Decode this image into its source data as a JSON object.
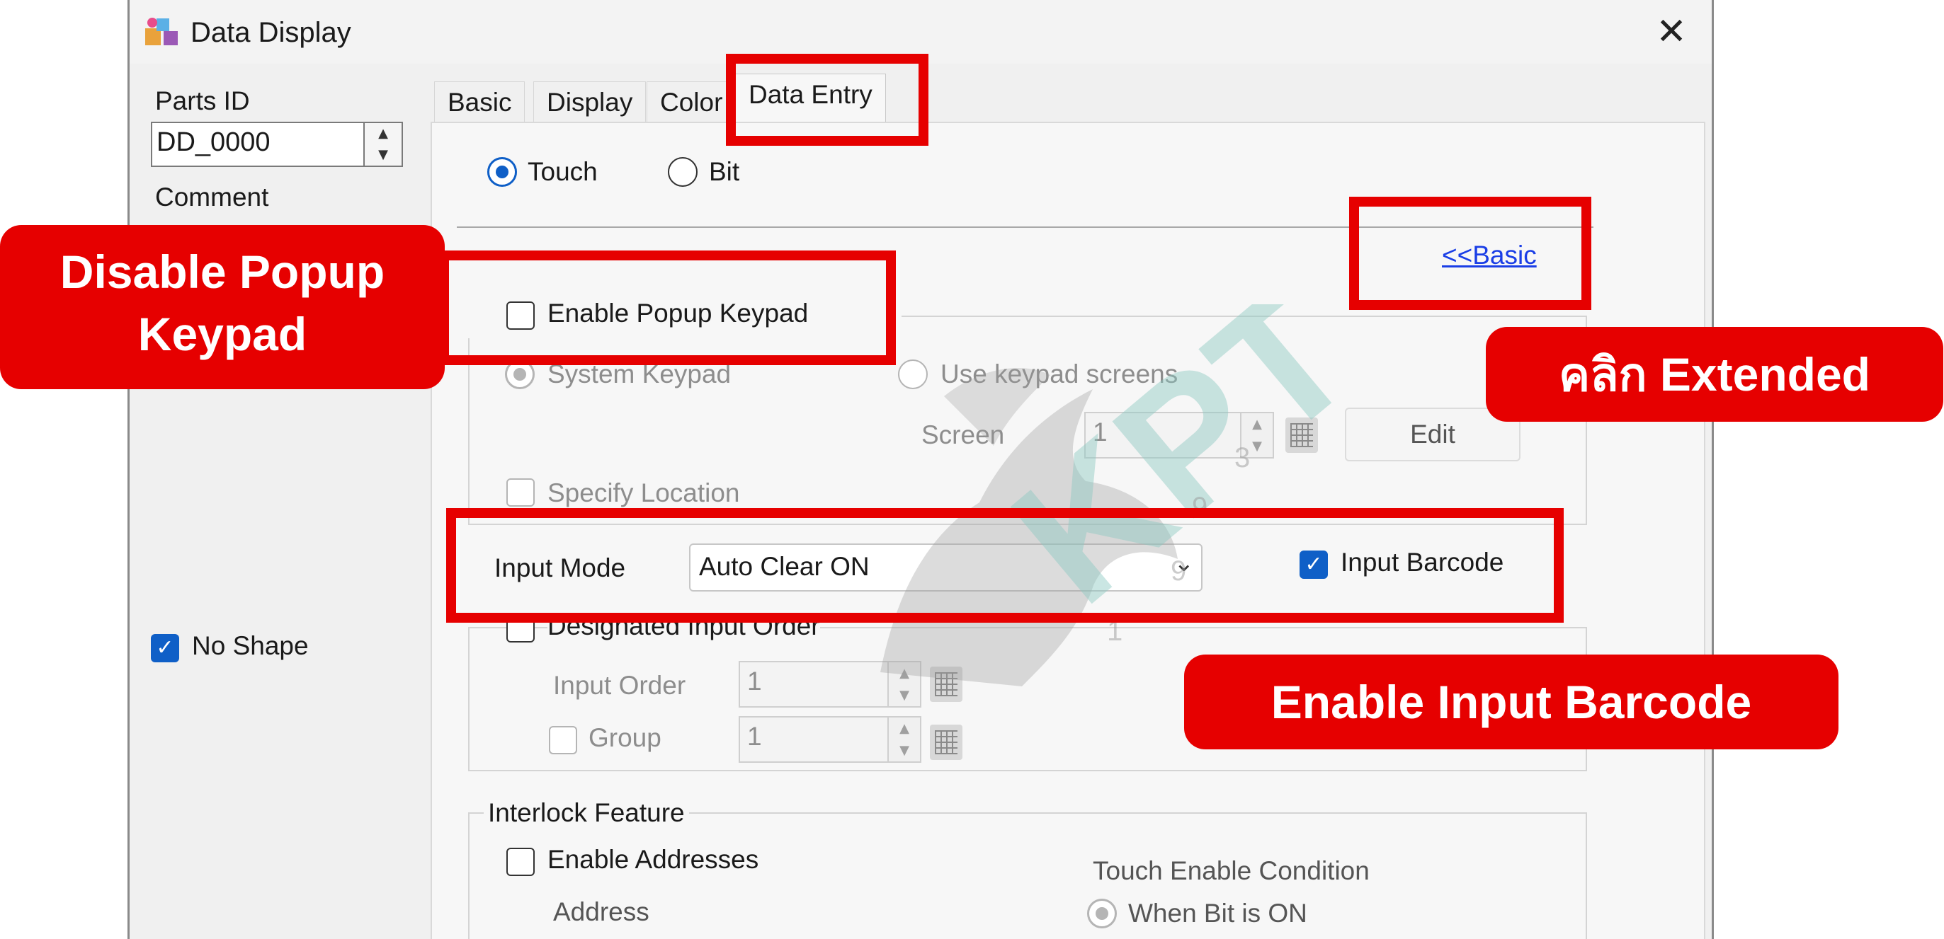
{
  "window": {
    "title": "Data Display",
    "close_glyph": "✕",
    "icon": "app-parts-icon"
  },
  "left_panel": {
    "parts_id_label": "Parts ID",
    "parts_id_value": "DD_0000",
    "comment_label": "Comment",
    "no_shape_label": "No Shape",
    "no_shape_checked": true
  },
  "tabs": [
    {
      "label": "Basic",
      "active": false
    },
    {
      "label": "Display",
      "active": false
    },
    {
      "label": "Color",
      "active": false
    },
    {
      "label": "Data Entry",
      "active": true
    }
  ],
  "data_entry": {
    "trigger_touch": "Touch",
    "trigger_bit": "Bit",
    "trigger_selected": "Touch",
    "basic_link": "<<Basic",
    "enable_popup_keypad": "Enable Popup Keypad",
    "enable_popup_keypad_checked": false,
    "system_keypad": "System Keypad",
    "use_keypad_screens": "Use keypad screens",
    "screen_label": "Screen",
    "screen_value": "1",
    "edit_button": "Edit",
    "specify_location": "Specify Location",
    "input_mode_label": "Input Mode",
    "input_mode_value": "Auto Clear ON",
    "input_barcode": "Input Barcode",
    "input_barcode_checked": true,
    "designated_input_order": "Designated Input Order",
    "input_order_label": "Input Order",
    "input_order_value": "1",
    "group_label": "Group",
    "group_value": "1",
    "interlock_title": "Interlock Feature",
    "enable_addresses": "Enable Addresses",
    "address_label": "Address",
    "touch_enable_condition": "Touch Enable Condition",
    "when_bit_is_on": "When Bit is ON"
  },
  "annotations": {
    "callout_popup_line1": "Disable Popup",
    "callout_popup_line2": "Keypad",
    "callout_extended": "คลิก Extended",
    "callout_barcode": "Enable Input Barcode",
    "highlight_color": "#e60000"
  },
  "watermark": {
    "text": "KPT",
    "digits": [
      "1",
      "9",
      "9",
      "3"
    ]
  }
}
